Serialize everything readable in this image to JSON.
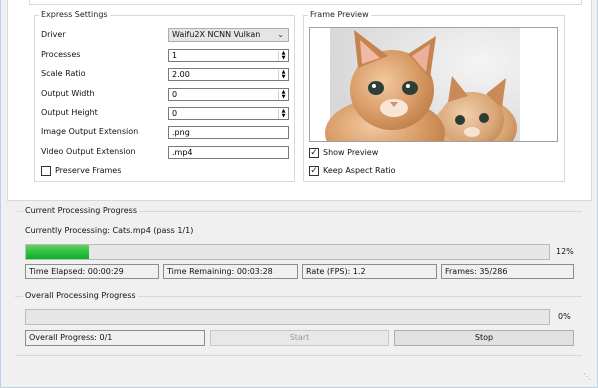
{
  "express_settings": {
    "title": "Express Settings",
    "driver": {
      "label": "Driver",
      "value": "Waifu2X NCNN Vulkan"
    },
    "processes": {
      "label": "Processes",
      "value": "1"
    },
    "scale_ratio": {
      "label": "Scale Ratio",
      "value": "2.00"
    },
    "output_width": {
      "label": "Output Width",
      "value": "0"
    },
    "output_height": {
      "label": "Output Height",
      "value": "0"
    },
    "image_ext": {
      "label": "Image Output Extension",
      "value": ".png"
    },
    "video_ext": {
      "label": "Video Output Extension",
      "value": ".mp4"
    },
    "preserve_frames": {
      "label": "Preserve Frames",
      "checked": false
    }
  },
  "frame_preview": {
    "title": "Frame Preview",
    "show_preview": {
      "label": "Show Preview",
      "checked": true
    },
    "keep_aspect": {
      "label": "Keep Aspect Ratio",
      "checked": true
    }
  },
  "current_progress": {
    "title": "Current Processing Progress",
    "processing_text": "Currently Processing: Cats.mp4 (pass 1/1)",
    "percent": 12,
    "percent_label": "12%",
    "time_elapsed": "Time Elapsed: 00:00:29",
    "time_remaining": "Time Remaining: 00:03:28",
    "rate": "Rate (FPS): 1.2",
    "frames": "Frames: 35/286"
  },
  "overall_progress": {
    "title": "Overall Processing Progress",
    "percent": 0,
    "percent_label": "0%",
    "overall_text": "Overall Progress: 0/1",
    "start_label": "Start",
    "stop_label": "Stop"
  },
  "colors": {
    "progress_fill": "#06b025",
    "groupbox_border": "#d9d9d9"
  }
}
